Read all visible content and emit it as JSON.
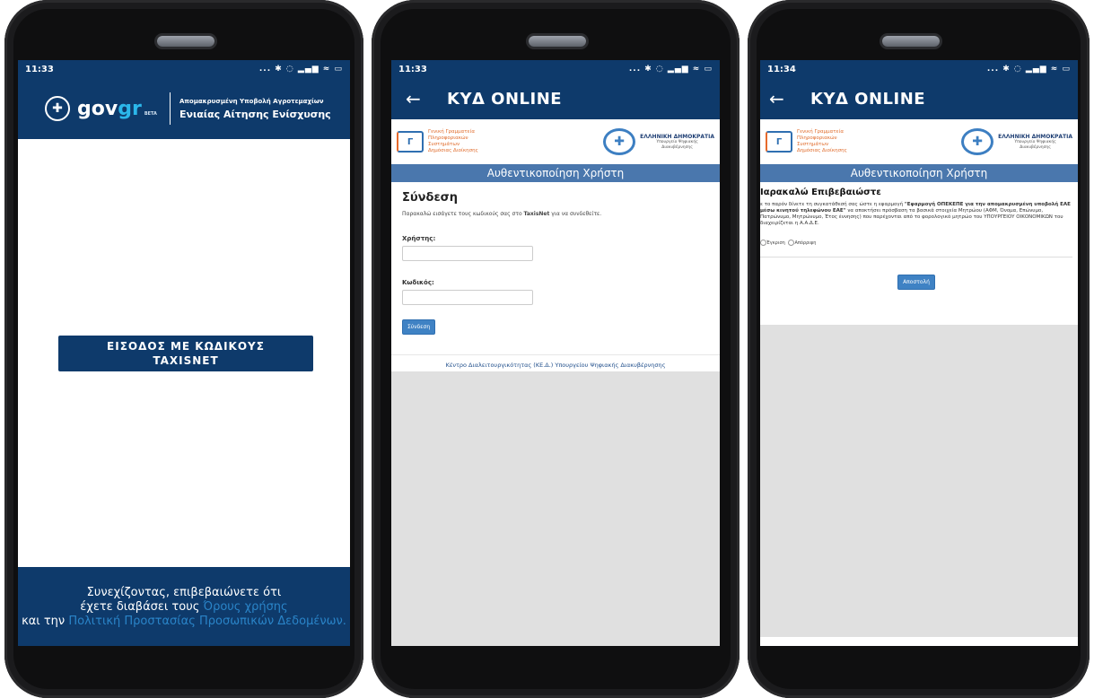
{
  "phone1": {
    "status": {
      "time": "11:33",
      "icons": "... ✱ ◌ ▂▄▆ ≈ ▭"
    },
    "header": {
      "logo_gov": "gov",
      "logo_gr": "gr",
      "logo_beta": "BETA",
      "subtitle_top": "Απομακρυσμένη Υποβολή Αγροτεμαχίων",
      "subtitle_main": "Ενιαίας Αίτησης Ενίσχυσης"
    },
    "login_button": {
      "line1": "ΕΙΣΟΔΟΣ ΜΕ ΚΩΔΙΚΟΥΣ",
      "line2": "TAXISNET"
    },
    "consent": {
      "part1": "Συνεχίζοντας, επιβεβαιώνετε ότι",
      "part2": "έχετε διαβάσει τους",
      "terms_link": "Όρους χρήσης",
      "part3": "και την",
      "privacy_link": "Πολιτική Προστασίας Προσωπικών Δεδομένων."
    }
  },
  "phone2": {
    "status": {
      "time": "11:33",
      "icons": "... ✱ ◌ ▂▄▆ ≈ ▭"
    },
    "app_title": "ΚΥΔ ONLINE",
    "gsis": {
      "line1": "Γενική Γραμματεία",
      "line2": "Πληροφοριακών",
      "line3": "Συστημάτων",
      "line4": "Δημόσιας Διοίκησης"
    },
    "hellenic": {
      "title": "ΕΛΛΗΝΙΚΗ ΔΗΜΟΚΡΑΤΙΑ",
      "sub1": "Υπουργείο Ψηφιακής",
      "sub2": "Διακυβέρνησης"
    },
    "auth_bar": "Αυθεντικοποίηση Χρήστη",
    "login_title": "Σύνδεση",
    "instructions_pre": "Παρακαλώ εισάγετε τους κωδικούς σας στο",
    "instructions_bold": "TaxisNet",
    "instructions_post": "για να συνδεθείτε.",
    "username_label": "Χρήστης:",
    "password_label": "Κωδικός:",
    "submit_label": "Σύνδεση",
    "footer": "Κέντρο Διαλειτουργικότητας (ΚΕ.Δ.) Υπουργείου Ψηφιακής Διακυβέρνησης"
  },
  "phone3": {
    "status": {
      "time": "11:34",
      "icons": "... ✱ ◌ ▂▄▆ ≈ ▭"
    },
    "app_title": "ΚΥΔ ONLINE",
    "gsis": {
      "line1": "Γενική Γραμματεία",
      "line2": "Πληροφοριακών",
      "line3": "Συστημάτων",
      "line4": "Δημόσιας Διοίκησης"
    },
    "hellenic": {
      "title": "ΕΛΛΗΝΙΚΗ ΔΗΜΟΚΡΑΤΙΑ",
      "sub1": "Υπουργείο Ψηφιακής",
      "sub2": "Διακυβέρνησης"
    },
    "auth_bar": "Αυθεντικοποίηση Χρήστη",
    "confirm_title": "Ιαρακαλώ Επιβεβαιώστε",
    "para_a": "ε το παρόν δίνετε τη συγκατάθεσή σας ώστε η εφαρμογή",
    "para_b": "\"Εφαρμογή ΟΠΕΚΕΠΕ για την απομακρυσμένη υποβολή ΕΑΕ μέσω κινητού τηλεφώνου ΕΑΕ\"",
    "para_c": "να αποκτήσει πρόσβαση τα βασικά στοιχεία Μητρώου (ΑΦΜ, Όνομα, Επώνυμο, Πατρώνυμο, Μητρώνυμο, Έτος έννησης) που παρέχονται από το φορολογικό μητρώο του ΥΠΟΥΡΓΕΙΟΥ ΟΙΚΟΝΟΜΙΚΩΝ του διαχειρίζεται η Α.Α.Δ.Ε.",
    "radio_yes": "Έγκριση",
    "radio_no": "Απόρριψη",
    "submit_label": "Αποστολή"
  }
}
